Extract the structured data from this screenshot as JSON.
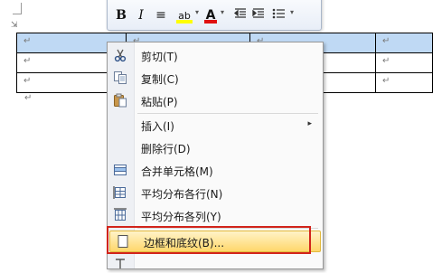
{
  "toolbar": {
    "bold": "B",
    "italic": "I",
    "center": "≡",
    "highlight": "ab",
    "font_color": "A",
    "dropdown": "▾"
  },
  "doc": {
    "pilcrow": "↵"
  },
  "context_menu": {
    "items": [
      {
        "label": "剪切(T)",
        "icon": "scissors-icon"
      },
      {
        "label": "复制(C)",
        "icon": "copy-icon"
      },
      {
        "label": "粘贴(P)",
        "icon": "paste-icon"
      },
      {
        "label": "插入(I)",
        "icon": "",
        "submenu": true
      },
      {
        "label": "删除行(D)",
        "icon": ""
      },
      {
        "label": "合并单元格(M)",
        "icon": "merge-cells-icon"
      },
      {
        "label": "平均分布各行(N)",
        "icon": "distribute-rows-icon"
      },
      {
        "label": "平均分布各列(Y)",
        "icon": "distribute-columns-icon"
      },
      {
        "label": "边框和底纹(B)...",
        "icon": "borders-shading-icon",
        "highlighted": true
      }
    ],
    "submenu_arrow": "▸"
  },
  "colors": {
    "highlight_border": "#d2241b",
    "selection": "#bfd9f4"
  }
}
